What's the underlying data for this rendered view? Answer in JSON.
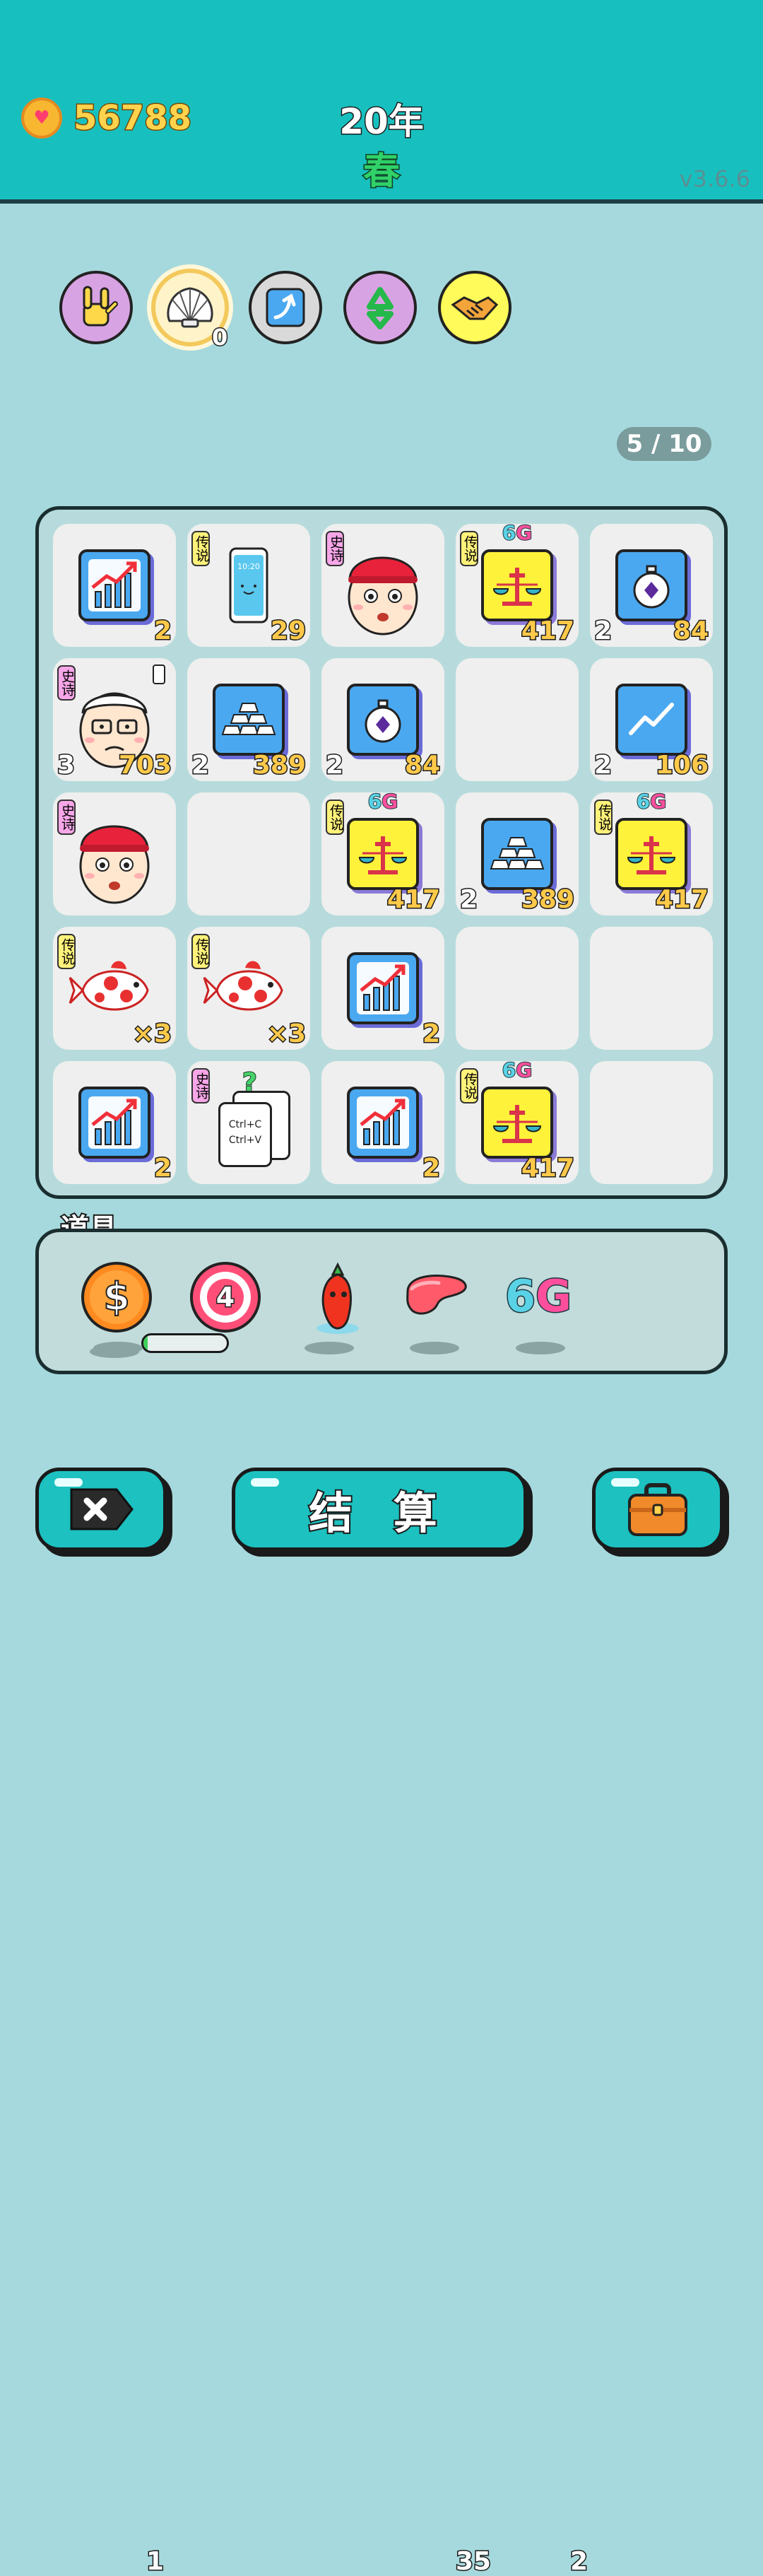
{
  "header": {
    "coins": "56788",
    "year": "20年",
    "season": "春",
    "version": "v3.6.6"
  },
  "abilities": [
    {
      "icon": "rock-hand-icon"
    },
    {
      "icon": "shell-icon",
      "badge": "0"
    },
    {
      "icon": "arrow-up-icon"
    },
    {
      "icon": "recycle-icon"
    },
    {
      "icon": "handshake-icon"
    }
  ],
  "board": {
    "counter": "5 / 10",
    "tags": {
      "legend": "传说",
      "epic": "史诗"
    },
    "g6_label": "6G",
    "cells": [
      {
        "item": "stock-chart",
        "value": "2"
      },
      {
        "item": "smartphone",
        "tag": "legend",
        "value": "29",
        "screen_time": "10:20"
      },
      {
        "item": "red-cap-man",
        "tag": "epic"
      },
      {
        "item": "balance-scale",
        "tag": "legend",
        "g6": true,
        "value": "417"
      },
      {
        "item": "stopwatch",
        "count": "2",
        "value": "84"
      },
      {
        "item": "old-man",
        "tag": "epic",
        "count": "3",
        "value": "703"
      },
      {
        "item": "gold-bars",
        "count": "2",
        "value": "389"
      },
      {
        "item": "stopwatch",
        "count": "2",
        "value": "84"
      },
      {
        "item": "empty"
      },
      {
        "item": "trend-line",
        "count": "2",
        "value": "106"
      },
      {
        "item": "red-cap-man",
        "tag": "epic"
      },
      {
        "item": "empty"
      },
      {
        "item": "balance-scale",
        "tag": "legend",
        "g6": true,
        "value": "417"
      },
      {
        "item": "gold-bars",
        "count": "2",
        "value": "389"
      },
      {
        "item": "balance-scale",
        "tag": "legend",
        "g6": true,
        "value": "417"
      },
      {
        "item": "koi-fish",
        "tag": "legend",
        "value": "×3"
      },
      {
        "item": "koi-fish",
        "tag": "legend",
        "value": "×3"
      },
      {
        "item": "stock-chart",
        "value": "2"
      },
      {
        "item": "empty"
      },
      {
        "item": "empty"
      },
      {
        "item": "stock-chart",
        "value": "2"
      },
      {
        "item": "copy-paste",
        "tag": "epic",
        "card_text": [
          "Ctrl+C",
          "Ctrl+V"
        ],
        "mark": "?"
      },
      {
        "item": "stock-chart",
        "value": "2"
      },
      {
        "item": "balance-scale",
        "tag": "legend",
        "g6": true,
        "value": "417"
      },
      {
        "item": "empty"
      }
    ]
  },
  "tools": {
    "label": "道具",
    "items": [
      {
        "icon": "dollar-coin-icon",
        "count": "1"
      },
      {
        "icon": "target-icon",
        "count": "4",
        "progress": 0.05
      },
      {
        "icon": "chili-pepper-icon"
      },
      {
        "icon": "liver-icon",
        "count": "35"
      },
      {
        "icon": "6g-icon",
        "text": "6G",
        "count": "2"
      }
    ]
  },
  "buttons": {
    "settle": "结 算"
  },
  "colors": {
    "teal": "#17c0bf",
    "background": "#a6d9dd",
    "value_yellow": "#ffc94a"
  }
}
